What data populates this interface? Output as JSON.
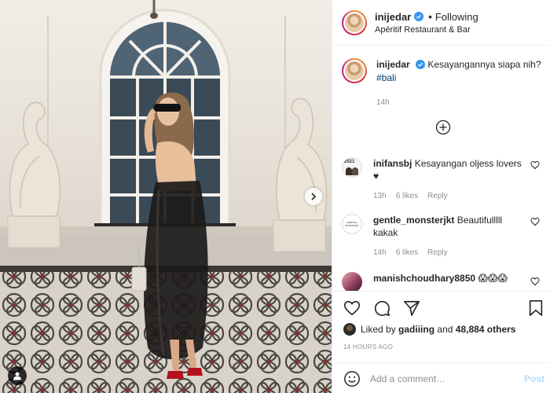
{
  "post": {
    "author": "inijedar",
    "follow_status": "Following",
    "separator": "•",
    "location": "Apéritif Restaurant & Bar",
    "caption_text": "Kesayangannya siapa nih?",
    "caption_hashtag": "#bali",
    "caption_time": "14h",
    "load_more_icon": "plus-circle-icon"
  },
  "comments": [
    {
      "username": "inifansbj",
      "text": "Kesayangan oljess lovers ♥",
      "time": "13h",
      "likes": "6 likes",
      "reply": "Reply",
      "avatar_badge": "2021"
    },
    {
      "username": "gentle_monsterjkt",
      "text": "Beautifulllll kakak",
      "time": "14h",
      "likes": "6 likes",
      "reply": "Reply",
      "avatar_badge": "GENTLE MONSTER"
    },
    {
      "username": "manishchoudhary8850",
      "text": "😱😱😱",
      "time": "",
      "likes": "",
      "reply": ""
    }
  ],
  "actions": {
    "liked_prefix": "Liked by",
    "liked_user": "gadiiing",
    "liked_and": "and",
    "liked_count": "48,884 others",
    "timestamp": "14 HOURS AGO",
    "comment_placeholder": "Add a comment…",
    "post_label": "Post"
  },
  "colors": {
    "link_blue": "#00376b",
    "verified_blue": "#3897f0",
    "post_button_disabled": "#b2dffc",
    "secondary_text": "#8e8e8e"
  }
}
